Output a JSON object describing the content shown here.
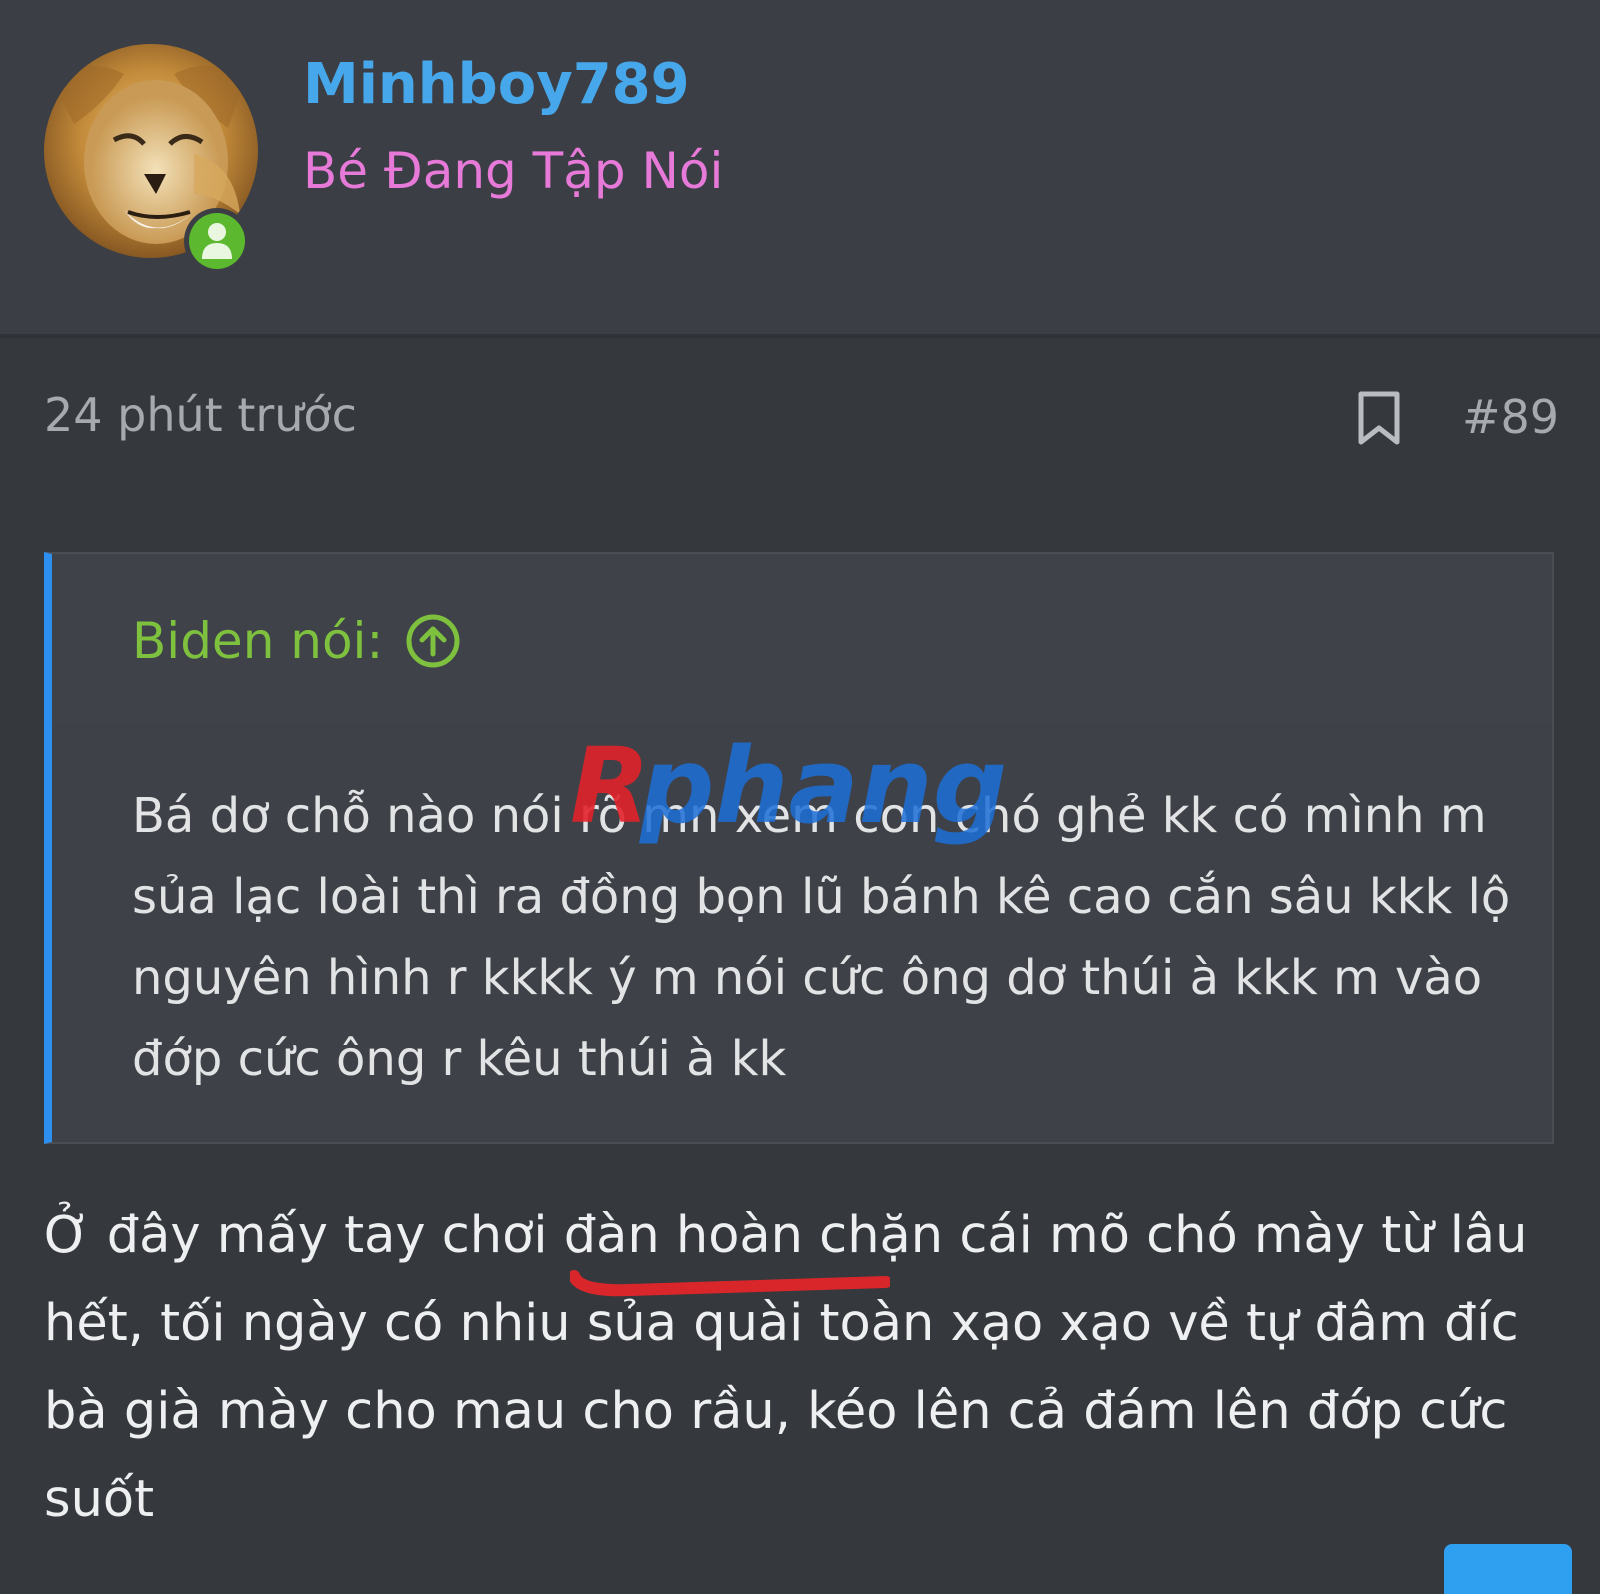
{
  "author": {
    "username": "Minhboy789",
    "rank_title": "Bé Đang Tập Nói",
    "online": true
  },
  "post": {
    "time": "24 phút trước",
    "number": "#89",
    "quote": {
      "author_label": "Biden nói:",
      "text": "Bá dơ chỗ nào nói rõ mn xem con chó ghẻ kk có mình m sủa lạc loài thì ra đồng bọn lũ bánh kê cao cắn sâu kkk lộ nguyên hình r kkkk ý m nói cức ông dơ thúi à kkk m vào đớp cức ông r kêu thúi à kk"
    },
    "body": "Ở đây mấy tay chơi đàn hoàn chặn cái mõ chó mày từ lâu hết, tối ngày có nhiu sủa quài toàn xạo xạo về tự đâm đíc bà già mày cho mau cho rầu, kéo lên cả đám lên đớp cức suốt"
  },
  "watermark": "Rphang",
  "colors": {
    "username": "#47a7eb",
    "rank_title": "#e77ad8",
    "quote_author": "#7ec13e",
    "quote_border": "#2d8fee",
    "online_badge": "#5cb82e",
    "underline": "#d9262b"
  }
}
